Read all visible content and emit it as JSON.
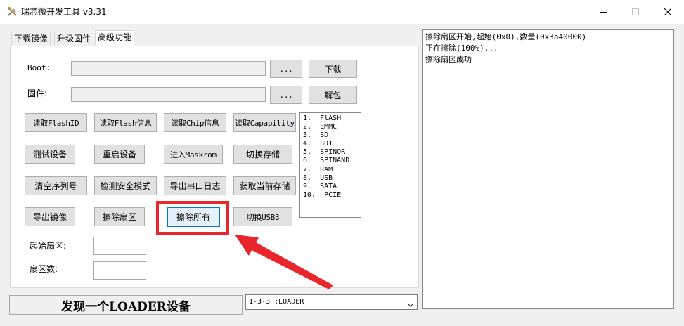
{
  "window": {
    "title": "瑞芯微开发工具 v3.31",
    "minimize_icon": "minimize-icon",
    "maximize_icon": "maximize-icon",
    "close_icon": "close-icon",
    "app_icon": "tools-icon"
  },
  "tabs": [
    {
      "label": "下载镜像"
    },
    {
      "label": "升级固件"
    },
    {
      "label": "高级功能",
      "active": true
    }
  ],
  "fields": {
    "boot_label": "Boot:",
    "boot_value": "",
    "boot_browse": "...",
    "boot_action": "下载",
    "firmware_label": "固件:",
    "firmware_value": "",
    "firmware_browse": "...",
    "firmware_action": "解包"
  },
  "buttons": {
    "read_flash_id": "读取FlashID",
    "read_flash_info": "读取Flash信息",
    "read_chip_info": "读取Chip信息",
    "read_capability": "读取Capability",
    "test_device": "测试设备",
    "reboot_device": "重启设备",
    "enter_maskrom": "进入Maskrom",
    "switch_storage": "切换存储",
    "clear_serial": "清空序列号",
    "detect_secure_mode": "检测安全模式",
    "export_serial_log": "导出串口日志",
    "get_current_storage": "获取当前存储",
    "export_image": "导出镜像",
    "erase_sector": "擦除扇区",
    "erase_all": "擦除所有",
    "switch_usb3": "切换USB3"
  },
  "sector": {
    "start_label": "起始扇区:",
    "start_value": "",
    "count_label": "扇区数:",
    "count_value": ""
  },
  "storage_list": [
    "1.  FlASH",
    "2.  EMMC",
    "3.  SD",
    "4.  SD1",
    "5.  SPINOR",
    "6.  SPINAND",
    "7.  RAM",
    "8.  USB",
    "9.  SATA",
    "10.  PCIE"
  ],
  "log": [
    "擦除扇区开始,起始(0x0),数量(0x3a40000)",
    "正在擦除(100%)...",
    "擦除扇区成功"
  ],
  "status": {
    "message": "发现一个LOADER设备",
    "device_selected": "1-3-3 :LOADER"
  },
  "colors": {
    "highlight": "#e8262b",
    "focus": "#0078d7"
  }
}
